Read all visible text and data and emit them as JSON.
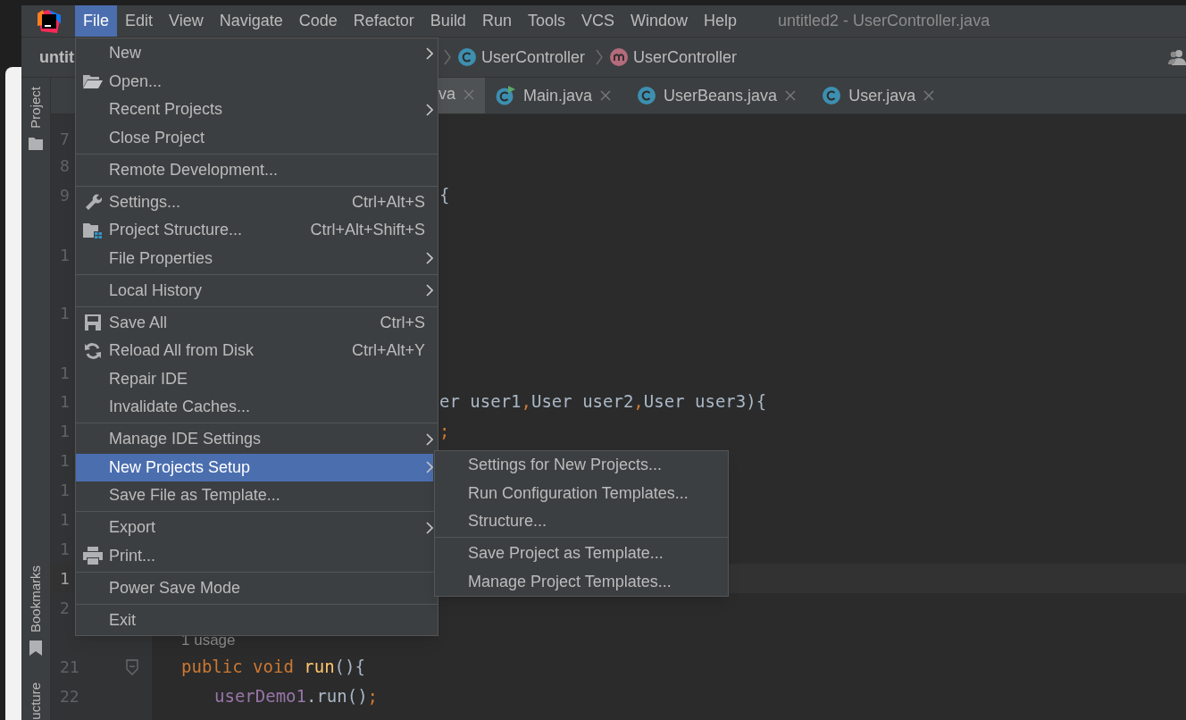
{
  "menu_bar": {
    "items": [
      {
        "label": "File",
        "selected": true
      },
      {
        "label": "Edit",
        "selected": false
      },
      {
        "label": "View",
        "selected": false
      },
      {
        "label": "Navigate",
        "selected": false
      },
      {
        "label": "Code",
        "selected": false
      },
      {
        "label": "Refactor",
        "selected": false
      },
      {
        "label": "Build",
        "selected": false
      },
      {
        "label": "Run",
        "selected": false
      },
      {
        "label": "Tools",
        "selected": false
      },
      {
        "label": "VCS",
        "selected": false
      },
      {
        "label": "Window",
        "selected": false
      },
      {
        "label": "Help",
        "selected": false
      }
    ],
    "title": "untitled2 - UserController.java"
  },
  "navigation_bar": {
    "project": "untit",
    "breadcrumbs": [
      {
        "kind": "class",
        "label": "UserController"
      },
      {
        "kind": "method",
        "label": "UserController"
      }
    ]
  },
  "tool_window_bar": {
    "top": [
      {
        "label": "Project"
      }
    ],
    "bottom": [
      {
        "label": "Bookmarks"
      },
      {
        "label": "ucture"
      }
    ]
  },
  "editor_tabs": {
    "tabs": [
      {
        "kind": "clipped",
        "label": "va",
        "selected": true
      },
      {
        "kind": "main",
        "label": "Main.java",
        "selected": false
      },
      {
        "kind": "class",
        "label": "UserBeans.java",
        "selected": false
      },
      {
        "kind": "class",
        "label": "User.java",
        "selected": false
      }
    ]
  },
  "editor": {
    "lines": [
      {
        "kind": "code",
        "number": "7",
        "current": false
      },
      {
        "kind": "code",
        "number": "8",
        "current": false
      },
      {
        "kind": "code",
        "number": "9",
        "current": false,
        "clipped": true,
        "tokens": [
          {
            "kind": "plain",
            "text": "{"
          }
        ]
      },
      {
        "kind": "code",
        "number": "1",
        "current": false
      },
      {
        "kind": "code",
        "number": "1",
        "current": false
      },
      {
        "kind": "code",
        "number": "1",
        "current": false
      },
      {
        "kind": "code",
        "number": "1",
        "current": false,
        "clipped": true,
        "tokens": [
          {
            "kind": "plain",
            "text": "er user1"
          },
          {
            "kind": "punct",
            "text": ","
          },
          {
            "kind": "plain",
            "text": "User user2"
          },
          {
            "kind": "punct",
            "text": ","
          },
          {
            "kind": "plain",
            "text": "User user3){"
          }
        ]
      },
      {
        "kind": "code",
        "number": "1",
        "current": false,
        "clipped": true,
        "tokens": [
          {
            "kind": "punct",
            "text": ";"
          }
        ]
      },
      {
        "kind": "code",
        "number": "1",
        "current": false
      },
      {
        "kind": "code",
        "number": "1",
        "current": false
      },
      {
        "kind": "code",
        "number": "1",
        "current": false
      },
      {
        "kind": "code",
        "number": "1",
        "current": false
      },
      {
        "kind": "code",
        "number": "1",
        "current": true
      },
      {
        "kind": "code",
        "number": "2",
        "current": false
      },
      {
        "kind": "hint",
        "text": "1 usage"
      },
      {
        "kind": "code",
        "number": "21",
        "current": false,
        "fold_marker": true,
        "tokens": [
          {
            "kind": "keyword",
            "text": "public "
          },
          {
            "kind": "keyword",
            "text": "void "
          },
          {
            "kind": "method",
            "text": "run"
          },
          {
            "kind": "plain",
            "text": "(){"
          }
        ],
        "children": [
          {
            "kind": "code",
            "number": "22",
            "current": false,
            "tokens": [
              {
                "kind": "field",
                "text": "userDemo1"
              },
              {
                "kind": "plain",
                "text": ".run()"
              },
              {
                "kind": "punct",
                "text": ";"
              }
            ]
          }
        ]
      }
    ]
  },
  "file_menu": {
    "groups": [
      [
        {
          "label": "New",
          "submenu": true,
          "selected": false
        },
        {
          "label": "Open...",
          "submenu": false,
          "selected": false
        },
        {
          "label": "Recent Projects",
          "submenu": true,
          "selected": false
        },
        {
          "label": "Close Project",
          "submenu": false,
          "selected": false
        }
      ],
      [
        {
          "label": "Remote Development...",
          "submenu": false,
          "selected": false
        }
      ],
      [
        {
          "label": "Settings...",
          "shortcut": "Ctrl+Alt+S",
          "submenu": false,
          "selected": false
        },
        {
          "label": "Project Structure...",
          "shortcut": "Ctrl+Alt+Shift+S",
          "submenu": false,
          "selected": false
        },
        {
          "label": "File Properties",
          "submenu": true,
          "selected": false
        }
      ],
      [
        {
          "label": "Local History",
          "submenu": true,
          "selected": false
        }
      ],
      [
        {
          "label": "Save All",
          "shortcut": "Ctrl+S",
          "submenu": false,
          "selected": false
        },
        {
          "label": "Reload All from Disk",
          "shortcut": "Ctrl+Alt+Y",
          "submenu": false,
          "selected": false
        },
        {
          "label": "Repair IDE",
          "submenu": false,
          "selected": false
        },
        {
          "label": "Invalidate Caches...",
          "submenu": false,
          "selected": false
        }
      ],
      [
        {
          "label": "Manage IDE Settings",
          "submenu": true,
          "selected": false
        },
        {
          "label": "New Projects Setup",
          "submenu": true,
          "selected": true
        },
        {
          "label": "Save File as Template...",
          "submenu": false,
          "selected": false
        }
      ],
      [
        {
          "label": "Export",
          "submenu": true,
          "selected": false
        },
        {
          "label": "Print...",
          "submenu": false,
          "selected": false
        }
      ],
      [
        {
          "label": "Power Save Mode",
          "submenu": false,
          "selected": false
        }
      ],
      [
        {
          "label": "Exit",
          "submenu": false,
          "selected": false
        }
      ]
    ]
  },
  "submenu": {
    "groups": [
      [
        {
          "label": "Settings for New Projects...",
          "selected": false
        },
        {
          "label": "Run Configuration Templates...",
          "selected": false
        },
        {
          "label": "Structure...",
          "selected": false
        }
      ],
      [
        {
          "label": "Save Project as Template...",
          "selected": false
        },
        {
          "label": "Manage Project Templates...",
          "selected": false
        }
      ]
    ]
  }
}
